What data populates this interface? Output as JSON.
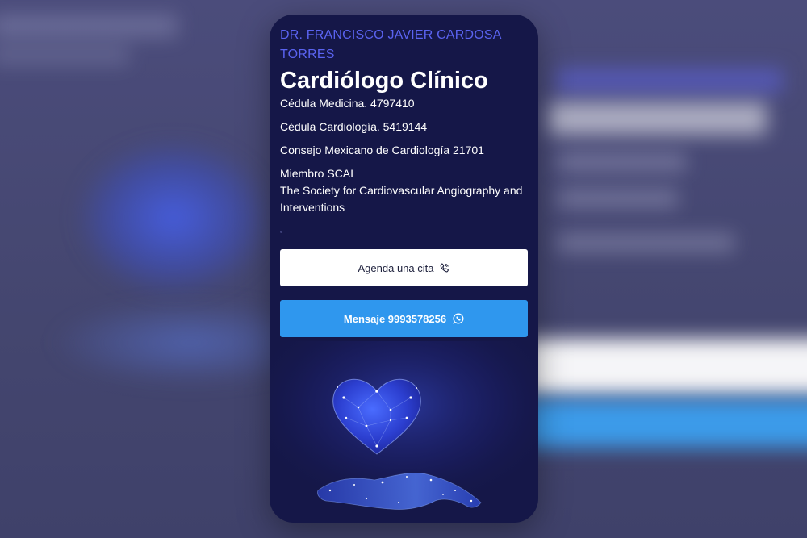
{
  "doctor": {
    "name": "DR. FRANCISCO JAVIER CARDOSA TORRES",
    "title": "Cardiólogo Clínico"
  },
  "credentials": {
    "medicina": "Cédula Medicina. 4797410",
    "cardiologia": "Cédula Cardiología. 5419144",
    "consejo": "Consejo Mexicano de Cardiología 21701",
    "scai_line1": "Miembro SCAI",
    "scai_line2": "The Society for Cardiovascular Angiography and Interventions"
  },
  "buttons": {
    "agenda_label": "Agenda una cita",
    "mensaje_label": "Mensaje 9993578256"
  },
  "icons": {
    "agenda": "phone-icon",
    "mensaje": "whatsapp-icon",
    "illustration": "heart-hand-illustration"
  },
  "colors": {
    "card_background": "#151748",
    "name_accent": "#5a63f0",
    "agenda_button": "#ffffff",
    "message_button": "#2f97ee"
  }
}
